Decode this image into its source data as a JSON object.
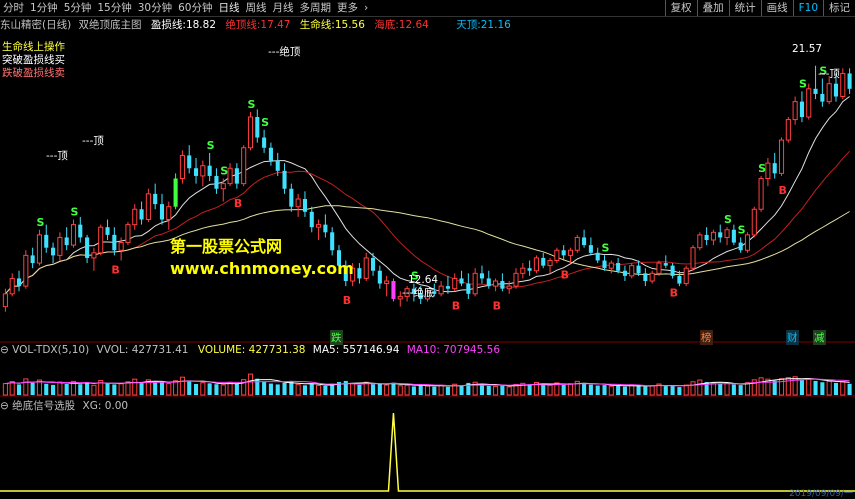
{
  "toolbar": {
    "tabs": [
      {
        "label": "分时"
      },
      {
        "label": "1分钟"
      },
      {
        "label": "5分钟"
      },
      {
        "label": "15分钟"
      },
      {
        "label": "30分钟"
      },
      {
        "label": "60分钟"
      },
      {
        "label": "日线"
      },
      {
        "label": "周线"
      },
      {
        "label": "月线"
      },
      {
        "label": "多周期"
      },
      {
        "label": "更多"
      }
    ],
    "more_arrow": "›",
    "buttons": [
      {
        "label": "复权"
      },
      {
        "label": "叠加"
      },
      {
        "label": "统计"
      },
      {
        "label": "画线"
      },
      {
        "label": "F10"
      },
      {
        "label": "标记"
      }
    ]
  },
  "main_info": {
    "stock": "东山精密(日线)",
    "indicator": "双绝顶底主图",
    "items": [
      {
        "label": "盈损线:",
        "value": "18.82",
        "color": "#ffffff"
      },
      {
        "label": "绝顶线:",
        "value": "17.47",
        "color": "#ff3030"
      },
      {
        "label": "生命线:",
        "value": "15.56",
        "color": "#ffff40"
      },
      {
        "label": "海底:",
        "value": "12.64",
        "color": "#ff3030"
      },
      {
        "label": "天顶:",
        "value": "21.16",
        "color": "#00c0ff"
      }
    ]
  },
  "legend": [
    {
      "label": "生命线上操作",
      "color": "#ffff40"
    },
    {
      "label": "突破盈损线买",
      "color": "#ffffff"
    },
    {
      "label": "跌破盈损线卖",
      "color": "#ff7070"
    }
  ],
  "annotations": {
    "top_left": "---顶",
    "top_left2": "---顶",
    "peak": "---绝顶",
    "bottom_price": "12.64",
    "bottom": "---绝底",
    "right_price": "21.57",
    "right_top": "---顶"
  },
  "watermark": {
    "line1": "第一股票公式网",
    "line2": "www.chnmoney.com"
  },
  "event_markers": [
    {
      "label": "跌",
      "color": "#40ff40"
    },
    {
      "label": "榜",
      "color": "#ff8040"
    },
    {
      "label": "财",
      "color": "#00c0ff"
    },
    {
      "label": "减",
      "color": "#40ff40"
    }
  ],
  "vol_info": {
    "name": "VOL-TDX(5,10)",
    "vvol": "VVOL: 427731.41",
    "volume": "VOLUME: 427731.38",
    "ma5": "MA5: 557146.94",
    "ma10": "MA10: 707945.56"
  },
  "signal_info": {
    "name": "绝底信号选股",
    "xg": "XG: 0.00"
  },
  "date_stamp": "2019/09/09/一",
  "colors": {
    "up": "#ff4040",
    "down": "#40e0ff",
    "ma_white": "#e0e0e0",
    "ma_red": "#c02020",
    "ma_yellow": "#e0e0a0",
    "buy": "#ff3030",
    "sell": "#40ff40"
  },
  "chart_data": {
    "type": "candlestick",
    "candles": [
      [
        12.2,
        12.9,
        12.0,
        12.7
      ],
      [
        12.7,
        13.5,
        12.6,
        13.3
      ],
      [
        13.3,
        13.6,
        12.8,
        13.0
      ],
      [
        13.0,
        14.4,
        12.9,
        14.2
      ],
      [
        14.2,
        14.5,
        13.7,
        13.9
      ],
      [
        13.9,
        15.2,
        13.8,
        15.0
      ],
      [
        15.0,
        15.4,
        14.3,
        14.5
      ],
      [
        14.5,
        14.7,
        13.9,
        14.2
      ],
      [
        14.2,
        15.1,
        14.0,
        14.9
      ],
      [
        14.9,
        15.3,
        14.4,
        14.6
      ],
      [
        14.6,
        15.6,
        14.5,
        15.4
      ],
      [
        15.4,
        15.7,
        14.7,
        14.9
      ],
      [
        14.9,
        15.0,
        13.9,
        14.1
      ],
      [
        14.1,
        14.5,
        13.6,
        14.3
      ],
      [
        14.3,
        15.4,
        14.2,
        15.3
      ],
      [
        15.3,
        15.6,
        14.8,
        15.0
      ],
      [
        15.0,
        15.3,
        14.2,
        14.4
      ],
      [
        14.4,
        14.9,
        14.0,
        14.7
      ],
      [
        14.7,
        15.5,
        14.6,
        15.4
      ],
      [
        15.4,
        16.2,
        15.2,
        16.0
      ],
      [
        16.0,
        16.3,
        15.4,
        15.6
      ],
      [
        15.6,
        16.8,
        15.5,
        16.6
      ],
      [
        16.6,
        17.0,
        16.0,
        16.2
      ],
      [
        16.2,
        16.6,
        15.4,
        15.6
      ],
      [
        15.6,
        16.3,
        15.2,
        16.1
      ],
      [
        16.1,
        17.4,
        16.0,
        17.2
      ],
      [
        17.2,
        18.3,
        17.0,
        18.1
      ],
      [
        18.1,
        18.5,
        17.4,
        17.6
      ],
      [
        17.6,
        18.0,
        17.0,
        17.3
      ],
      [
        17.3,
        17.9,
        16.9,
        17.7
      ],
      [
        17.7,
        18.2,
        17.1,
        17.3
      ],
      [
        17.3,
        17.6,
        16.6,
        16.8
      ],
      [
        16.8,
        17.2,
        16.3,
        17.0
      ],
      [
        17.0,
        17.8,
        16.9,
        17.6
      ],
      [
        17.6,
        17.8,
        16.8,
        17.0
      ],
      [
        17.0,
        18.5,
        16.9,
        18.4
      ],
      [
        18.4,
        19.8,
        18.3,
        19.6
      ],
      [
        19.6,
        19.9,
        18.6,
        18.8
      ],
      [
        18.8,
        19.1,
        18.2,
        18.4
      ],
      [
        18.4,
        18.6,
        17.7,
        17.9
      ],
      [
        17.9,
        18.2,
        17.3,
        17.5
      ],
      [
        17.5,
        17.8,
        16.6,
        16.8
      ],
      [
        16.8,
        17.0,
        15.9,
        16.1
      ],
      [
        16.1,
        16.6,
        15.7,
        16.4
      ],
      [
        16.4,
        16.7,
        15.7,
        15.9
      ],
      [
        15.9,
        16.1,
        15.1,
        15.3
      ],
      [
        15.3,
        15.6,
        14.8,
        15.4
      ],
      [
        15.4,
        15.8,
        14.9,
        15.1
      ],
      [
        15.1,
        15.3,
        14.2,
        14.4
      ],
      [
        14.4,
        14.6,
        13.6,
        13.8
      ],
      [
        13.8,
        14.0,
        13.0,
        13.2
      ],
      [
        13.2,
        13.9,
        13.0,
        13.7
      ],
      [
        13.7,
        13.9,
        13.1,
        13.3
      ],
      [
        13.3,
        14.3,
        13.2,
        14.1
      ],
      [
        14.1,
        14.3,
        13.4,
        13.6
      ],
      [
        13.6,
        13.8,
        12.9,
        13.1
      ],
      [
        13.1,
        13.4,
        12.6,
        13.2
      ],
      [
        13.2,
        13.3,
        12.4,
        12.5
      ],
      [
        12.5,
        12.8,
        12.2,
        12.6
      ],
      [
        12.6,
        13.0,
        12.4,
        12.9
      ],
      [
        12.9,
        13.1,
        12.4,
        12.7
      ],
      [
        12.7,
        13.0,
        12.3,
        12.5
      ],
      [
        12.5,
        12.9,
        12.4,
        12.8
      ],
      [
        12.8,
        13.1,
        12.6,
        12.7
      ],
      [
        12.7,
        13.2,
        12.6,
        13.0
      ],
      [
        13.0,
        13.4,
        12.7,
        12.9
      ],
      [
        12.9,
        13.5,
        12.8,
        13.3
      ],
      [
        13.3,
        13.6,
        13.0,
        13.1
      ],
      [
        13.1,
        13.5,
        12.5,
        12.7
      ],
      [
        12.7,
        13.7,
        12.6,
        13.5
      ],
      [
        13.5,
        13.8,
        13.1,
        13.3
      ],
      [
        13.3,
        13.6,
        12.9,
        13.0
      ],
      [
        13.0,
        13.3,
        12.8,
        13.2
      ],
      [
        13.2,
        13.5,
        12.8,
        12.9
      ],
      [
        12.9,
        13.2,
        12.7,
        13.0
      ],
      [
        13.0,
        13.7,
        12.9,
        13.5
      ],
      [
        13.5,
        13.9,
        13.3,
        13.7
      ],
      [
        13.7,
        14.0,
        13.4,
        13.6
      ],
      [
        13.6,
        14.2,
        13.5,
        14.1
      ],
      [
        14.1,
        14.3,
        13.7,
        13.8
      ],
      [
        13.8,
        14.1,
        13.5,
        14.0
      ],
      [
        14.0,
        14.5,
        13.9,
        14.4
      ],
      [
        14.4,
        14.6,
        14.0,
        14.2
      ],
      [
        14.2,
        14.5,
        13.9,
        14.4
      ],
      [
        14.4,
        15.0,
        14.3,
        14.9
      ],
      [
        14.9,
        15.2,
        14.5,
        14.6
      ],
      [
        14.6,
        14.9,
        14.2,
        14.3
      ],
      [
        14.3,
        14.5,
        13.9,
        14.0
      ],
      [
        14.0,
        14.2,
        13.6,
        13.7
      ],
      [
        13.7,
        14.0,
        13.5,
        13.9
      ],
      [
        13.9,
        14.1,
        13.5,
        13.6
      ],
      [
        13.6,
        13.8,
        13.2,
        13.4
      ],
      [
        13.4,
        13.9,
        13.3,
        13.8
      ],
      [
        13.8,
        14.0,
        13.4,
        13.5
      ],
      [
        13.5,
        13.7,
        13.0,
        13.2
      ],
      [
        13.2,
        13.6,
        13.1,
        13.5
      ],
      [
        13.5,
        14.0,
        13.4,
        13.9
      ],
      [
        13.9,
        14.2,
        13.7,
        13.8
      ],
      [
        13.8,
        13.9,
        13.3,
        13.4
      ],
      [
        13.4,
        13.6,
        13.0,
        13.1
      ],
      [
        13.1,
        13.8,
        13.0,
        13.7
      ],
      [
        13.7,
        14.6,
        13.6,
        14.5
      ],
      [
        14.5,
        15.1,
        14.4,
        15.0
      ],
      [
        15.0,
        15.3,
        14.6,
        14.8
      ],
      [
        14.8,
        15.2,
        14.6,
        15.1
      ],
      [
        15.1,
        15.4,
        14.7,
        14.9
      ],
      [
        14.9,
        15.3,
        14.6,
        15.2
      ],
      [
        15.2,
        15.4,
        14.6,
        14.7
      ],
      [
        14.7,
        14.9,
        14.3,
        14.4
      ],
      [
        14.4,
        15.1,
        14.3,
        15.0
      ],
      [
        15.0,
        16.1,
        14.9,
        16.0
      ],
      [
        16.0,
        17.3,
        15.9,
        17.2
      ],
      [
        17.2,
        18.0,
        16.9,
        17.8
      ],
      [
        17.8,
        18.2,
        17.2,
        17.4
      ],
      [
        17.4,
        18.8,
        17.3,
        18.7
      ],
      [
        18.7,
        19.6,
        18.6,
        19.5
      ],
      [
        19.5,
        20.4,
        19.3,
        20.2
      ],
      [
        20.2,
        20.6,
        19.4,
        19.6
      ],
      [
        19.6,
        20.9,
        19.5,
        20.7
      ],
      [
        20.7,
        21.6,
        20.3,
        20.5
      ],
      [
        20.5,
        21.1,
        20.0,
        20.2
      ],
      [
        20.2,
        21.2,
        20.1,
        20.9
      ],
      [
        20.9,
        21.3,
        20.2,
        20.4
      ],
      [
        20.4,
        21.5,
        20.3,
        21.3
      ],
      [
        21.3,
        21.5,
        20.5,
        20.7
      ]
    ],
    "price_range": [
      11.6,
      22.8
    ],
    "volume": [
      5.2,
      6.1,
      4.8,
      7.3,
      5.5,
      6.8,
      5.1,
      4.6,
      5.9,
      5.0,
      6.2,
      4.9,
      5.7,
      4.4,
      6.6,
      5.3,
      4.8,
      5.1,
      6.0,
      7.2,
      5.4,
      6.9,
      5.6,
      5.9,
      5.2,
      6.5,
      8.1,
      6.3,
      5.0,
      5.6,
      5.3,
      4.9,
      4.6,
      5.8,
      5.1,
      7.0,
      9.5,
      7.4,
      5.9,
      5.2,
      4.8,
      5.5,
      6.3,
      4.7,
      4.4,
      5.0,
      4.3,
      4.1,
      5.2,
      5.9,
      6.4,
      5.1,
      4.6,
      5.8,
      4.9,
      5.3,
      4.5,
      5.6,
      4.2,
      4.4,
      3.9,
      4.6,
      4.1,
      3.8,
      4.4,
      3.7,
      4.9,
      4.2,
      5.5,
      5.8,
      4.6,
      4.1,
      3.9,
      4.3,
      3.7,
      4.8,
      5.3,
      4.9,
      5.7,
      4.6,
      4.4,
      5.5,
      4.8,
      5.1,
      6.2,
      5.0,
      4.7,
      4.3,
      4.5,
      4.0,
      4.2,
      3.8,
      4.6,
      4.1,
      3.9,
      4.3,
      5.0,
      4.4,
      4.1,
      3.6,
      4.5,
      6.0,
      6.8,
      5.9,
      5.4,
      5.0,
      5.3,
      4.8,
      4.5,
      5.6,
      6.9,
      7.8,
      7.2,
      6.5,
      7.4,
      7.9,
      8.3,
      6.7,
      7.1,
      6.4,
      5.8,
      6.2,
      5.5,
      6.0,
      5.1
    ],
    "volume_range": [
      0,
      10
    ],
    "signal": {
      "index": 57,
      "value": 1
    }
  }
}
